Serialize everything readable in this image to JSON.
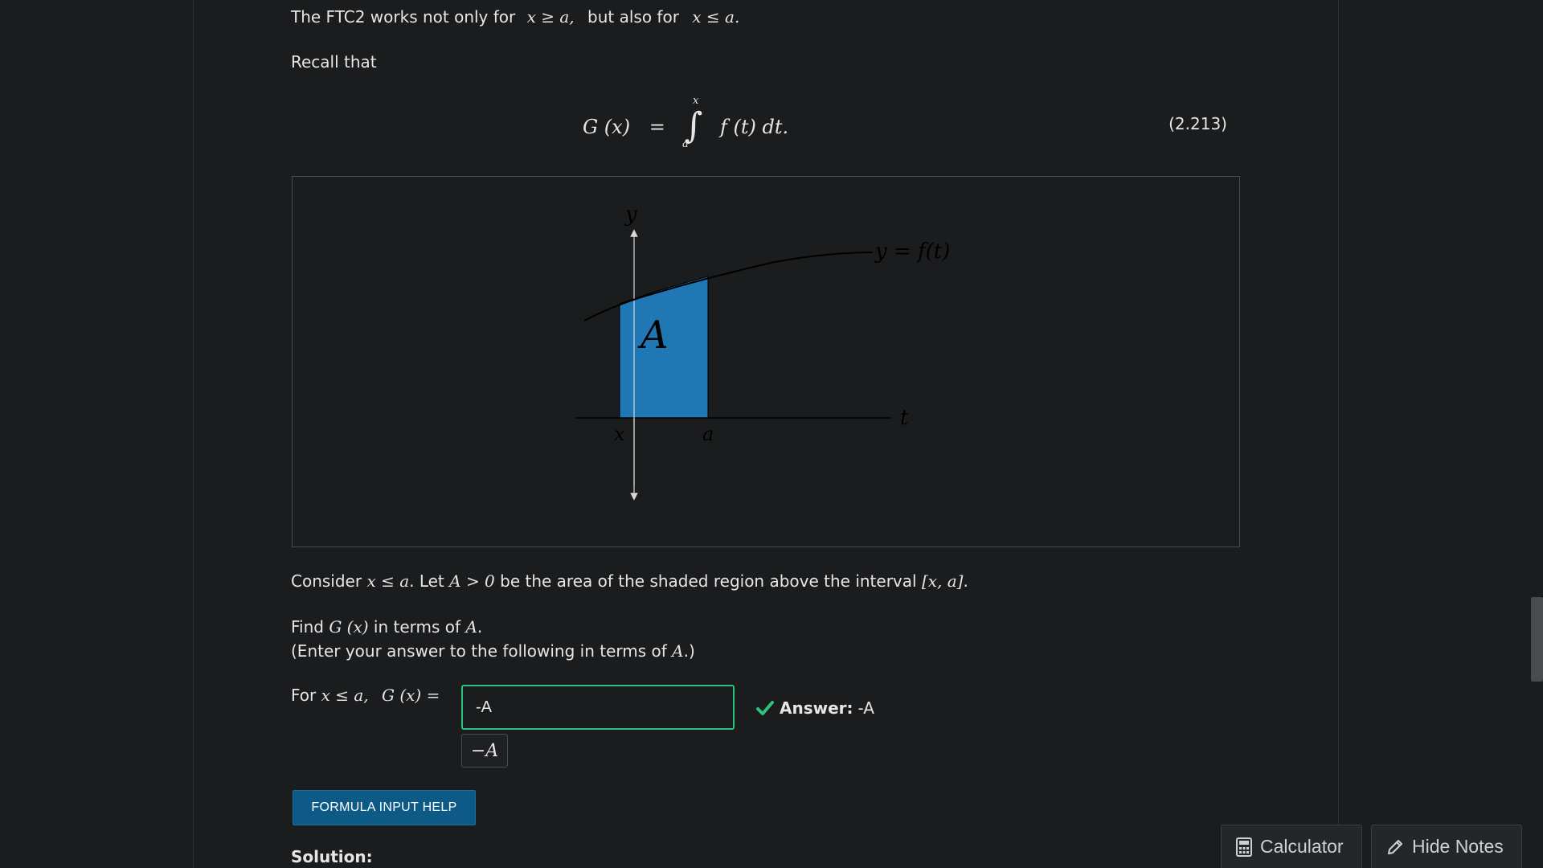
{
  "intro": {
    "ftc_prefix": "The FTC2 works not only for",
    "cond1": "x ≥ a,",
    "ftc_middle": "but also for",
    "cond2": "x ≤ a."
  },
  "recall": "Recall that",
  "equation": {
    "lhs": "G (x)",
    "equals": "=",
    "upper": "x",
    "lower": "a",
    "integrand": "f (t) dt.",
    "number": "(2.213)"
  },
  "figure": {
    "y_axis_label": "y",
    "t_axis_label": "t",
    "curve_label": "y = f(t)",
    "area_label": "A",
    "x_tick": "x",
    "a_tick": "a",
    "fill_color": "#1f77b4"
  },
  "consider": {
    "t1": "Consider",
    "m1": "x ≤ a",
    "t2": ". Let",
    "m2": "A > 0",
    "t3": "be the area of the shaded region above the interval",
    "m3": "[x, a]",
    "t4": "."
  },
  "find": {
    "t1": "Find",
    "m1": "G (x)",
    "t2": "in terms of",
    "m2": "A",
    "t3": "."
  },
  "enter": {
    "t1": "(Enter your answer to the following in terms of",
    "m1": "A",
    "t2": ".)"
  },
  "prompt": {
    "t1": "For",
    "m1": "x ≤ a,",
    "m2": "G (x) ="
  },
  "answer_input_value": "-A",
  "preview": "−A",
  "answer_status": {
    "label": "Answer:",
    "value": "-A",
    "color": "#2ec27e"
  },
  "formula_help_label": "FORMULA INPUT HELP",
  "solution_title": "Solution:",
  "float_buttons": {
    "calculator": "Calculator",
    "hide_notes": "Hide Notes"
  }
}
